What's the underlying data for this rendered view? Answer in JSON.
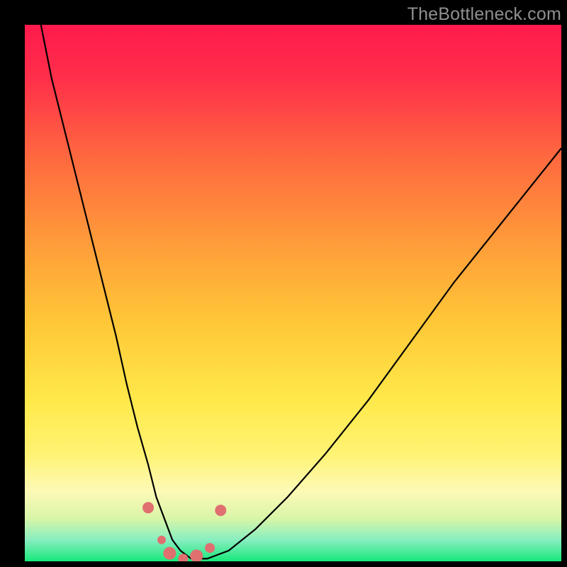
{
  "watermark": "TheBottleneck.com",
  "chart_data": {
    "type": "line",
    "title": "",
    "xlabel": "",
    "ylabel": "",
    "xlim": [
      0,
      100
    ],
    "ylim": [
      0,
      100
    ],
    "background_gradient": {
      "stops": [
        {
          "offset": 0.0,
          "color": "#ff1a4d"
        },
        {
          "offset": 0.1,
          "color": "#ff2f4a"
        },
        {
          "offset": 0.25,
          "color": "#ff6a3f"
        },
        {
          "offset": 0.4,
          "color": "#ff9a3a"
        },
        {
          "offset": 0.55,
          "color": "#ffc637"
        },
        {
          "offset": 0.7,
          "color": "#ffe94a"
        },
        {
          "offset": 0.8,
          "color": "#fff373"
        },
        {
          "offset": 0.87,
          "color": "#fdf9b7"
        },
        {
          "offset": 0.92,
          "color": "#d8f6a8"
        },
        {
          "offset": 0.96,
          "color": "#88eec0"
        },
        {
          "offset": 1.0,
          "color": "#17e87a"
        }
      ]
    },
    "series": [
      {
        "name": "bottleneck-curve",
        "type": "line",
        "x": [
          3,
          5,
          8,
          11,
          14,
          17,
          19,
          21,
          23,
          24.5,
          26,
          27.5,
          29,
          31,
          34,
          38,
          43,
          49,
          56,
          64,
          72,
          80,
          88,
          96,
          100
        ],
        "y": [
          100,
          90,
          78,
          66,
          54,
          42,
          33,
          25,
          18,
          12,
          8,
          4,
          2,
          0.5,
          0.5,
          2,
          6,
          12,
          20,
          30,
          41,
          52,
          62,
          72,
          77
        ]
      }
    ],
    "markers": {
      "name": "highlight-dots",
      "color": "#e07070",
      "points": [
        {
          "x": 23.0,
          "y": 10.0,
          "r": 8
        },
        {
          "x": 25.5,
          "y": 4.0,
          "r": 6
        },
        {
          "x": 27.0,
          "y": 1.5,
          "r": 9
        },
        {
          "x": 29.5,
          "y": 0.5,
          "r": 7
        },
        {
          "x": 32.0,
          "y": 1.0,
          "r": 9
        },
        {
          "x": 34.5,
          "y": 2.5,
          "r": 7
        },
        {
          "x": 36.5,
          "y": 9.5,
          "r": 8
        }
      ]
    }
  }
}
